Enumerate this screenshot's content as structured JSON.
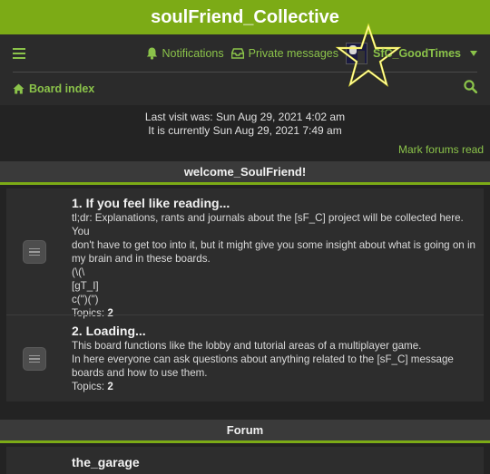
{
  "site": {
    "title": "soulFriend_Collective"
  },
  "navbar": {
    "menu_icon": "hamburger-icon",
    "notifications_label": "Notifications",
    "notifications_icon": "bell-icon",
    "messages_label": "Private messages",
    "messages_icon": "inbox-icon",
    "username": "SfC_GoodTimes",
    "board_index_label": "Board index",
    "board_index_icon": "home-icon",
    "search_icon": "search-icon"
  },
  "info": {
    "last_visit": "Last visit was: Sun Aug 29, 2021 4:02 am",
    "current_time": "It is currently Sun Aug 29, 2021 7:49 am",
    "mark_read": "Mark forums read"
  },
  "categories": [
    {
      "title": "welcome_SoulFriend!",
      "forums": [
        {
          "title": "1. If you feel like reading...",
          "description_lines": [
            "tl;dr: Explanations, rants and journals about the [sF_C] project will be collected here. You",
            "don't have to get too into it, but it might give you some insight about what is going on in",
            "my brain and in these boards.",
            "(\\(\\",
            "[gT_I]",
            "c(\")(\")"
          ],
          "topics_label": "Topics:",
          "topics_count": "2"
        },
        {
          "title": "2. Loading...",
          "description_lines": [
            "This board functions like the lobby and tutorial areas of a multiplayer game.",
            "In here everyone can ask questions about anything related to the [sF_C] message",
            "boards and how to use them."
          ],
          "topics_label": "Topics:",
          "topics_count": "2"
        }
      ]
    },
    {
      "title": "Forum",
      "forums": [
        {
          "title": "the_garage"
        }
      ]
    }
  ],
  "colors": {
    "accent": "#7cab16",
    "link": "#8bc34a",
    "background": "#232323",
    "panel": "#2d2d2d"
  }
}
